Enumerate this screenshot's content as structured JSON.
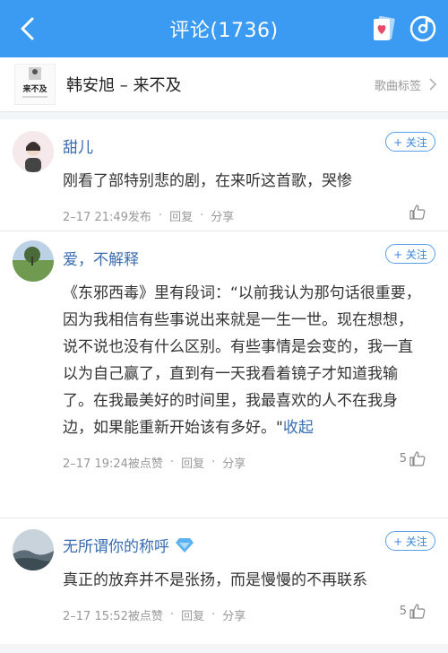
{
  "header": {
    "title": "评论(1736)"
  },
  "song": {
    "title": "韩安旭 – 来不及",
    "tag_label": "歌曲标签",
    "cover_text": "来不及"
  },
  "comments": [
    {
      "user": "甜儿",
      "follow_label": "+ 关注",
      "text": "刚看了部特别悲的剧，在来听这首歌，哭惨",
      "time": "2–17 21:49发布",
      "reply": "回复",
      "share": "分享",
      "likes": ""
    },
    {
      "user": "爱，不解释",
      "follow_label": "+ 关注",
      "text": "《东邪西毒》里有段词：“以前我认为那句话很重要，因为我相信有些事说出来就是一生一世。现在想想，说不说也没有什么区别。有些事情是会变的，我一直以为自己赢了，直到有一天我看着镜子才知道我输了。在我最美好的时间里，我最喜欢的人不在我身边，如果能重新开始该有多好。\"",
      "collapse_label": "收起",
      "time": "2–17 19:24被点赞",
      "reply": "回复",
      "share": "分享",
      "likes": "5"
    },
    {
      "user": "无所谓你的称呼",
      "follow_label": "+ 关注",
      "text": "真正的放弃并不是张扬，而是慢慢的不再联系",
      "time": "2–17 15:52被点赞",
      "reply": "回复",
      "share": "分享",
      "likes": "5"
    }
  ],
  "colors": {
    "topbar": "#3b9bf2",
    "username": "#3a6cb0",
    "follow_border": "#5aa0e6"
  }
}
